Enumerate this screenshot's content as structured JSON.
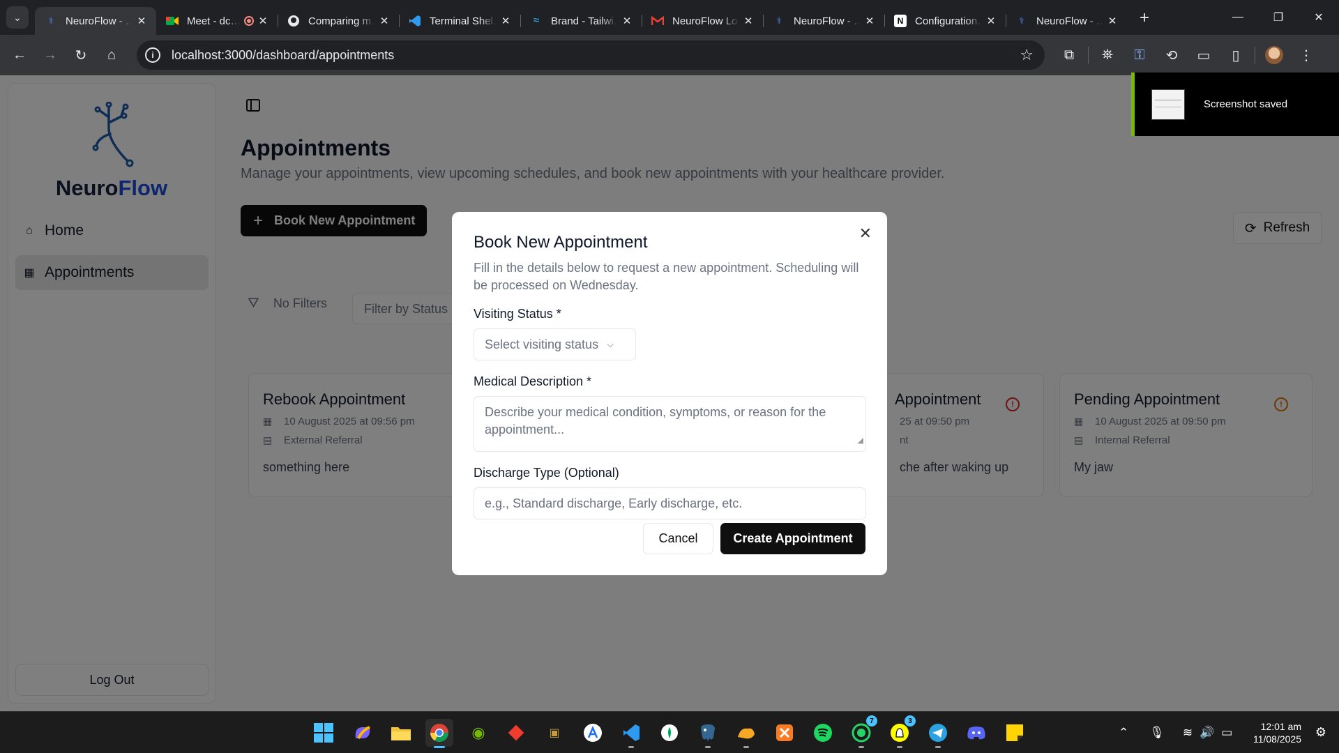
{
  "browser": {
    "tabs": [
      {
        "title": "NeuroFlow - …",
        "icon": "neuroflow-icon",
        "active": true
      },
      {
        "title": "Meet - dc…",
        "icon": "google-meet-icon",
        "recording": true
      },
      {
        "title": "Comparing m…",
        "icon": "github-icon"
      },
      {
        "title": "Terminal Shel…",
        "icon": "vscode-icon"
      },
      {
        "title": "Brand - Tailwi…",
        "icon": "tailwind-icon"
      },
      {
        "title": "NeuroFlow Lo…",
        "icon": "gmail-icon"
      },
      {
        "title": "NeuroFlow - …",
        "icon": "neuroflow-icon"
      },
      {
        "title": "Configuration…",
        "icon": "notion-icon"
      },
      {
        "title": "NeuroFlow - …",
        "icon": "neuroflow-icon"
      }
    ],
    "url": "localhost:3000/dashboard/appointments"
  },
  "sidebar": {
    "brand_prefix": "Neuro",
    "brand_suffix": "Flow",
    "items": [
      {
        "label": "Home",
        "icon": "home-icon"
      },
      {
        "label": "Appointments",
        "icon": "calendar-icon",
        "active": true
      }
    ],
    "logout_label": "Log Out"
  },
  "page": {
    "title": "Appointments",
    "subtitle": "Manage your appointments, view upcoming schedules, and book new appointments with your healthcare provider.",
    "book_button": "Book New Appointment",
    "refresh_button": "Refresh",
    "filters_label": "No Filters",
    "filter_status_placeholder": "Filter by Status"
  },
  "cards": [
    {
      "title": "Rebook Appointment",
      "date": "10 August 2025 at 09:56 pm",
      "referral": "External Referral",
      "description": "something here"
    },
    {
      "title": "Appointment",
      "date": "25 at 09:50 pm",
      "referral": "nt",
      "description": "che after waking up",
      "status_color": "#dc2626"
    },
    {
      "title": "Pending Appointment",
      "date": "10 August 2025 at 09:50 pm",
      "referral": "Internal Referral",
      "description": "My jaw",
      "status_color": "#d97706"
    }
  ],
  "modal": {
    "title": "Book New Appointment",
    "description": "Fill in the details below to request a new appointment. Scheduling will be processed on Wednesday.",
    "visiting_status_label": "Visiting Status *",
    "visiting_status_placeholder": "Select visiting status",
    "medical_description_label": "Medical Description *",
    "medical_description_placeholder": "Describe your medical condition, symptoms, or reason for the appointment...",
    "discharge_type_label": "Discharge Type (Optional)",
    "discharge_type_placeholder": "e.g., Standard discharge, Early discharge, etc.",
    "cancel_label": "Cancel",
    "create_label": "Create Appointment"
  },
  "toast": {
    "text": "Screenshot saved"
  },
  "taskbar": {
    "time": "12:01 am",
    "date": "11/08/2025",
    "badges": {
      "whatsapp": "7",
      "snapchat": "3"
    }
  },
  "colors": {
    "accent": "#1d4ed8",
    "primary_button": "#0f0f10",
    "toast_bar": "#76b900"
  }
}
